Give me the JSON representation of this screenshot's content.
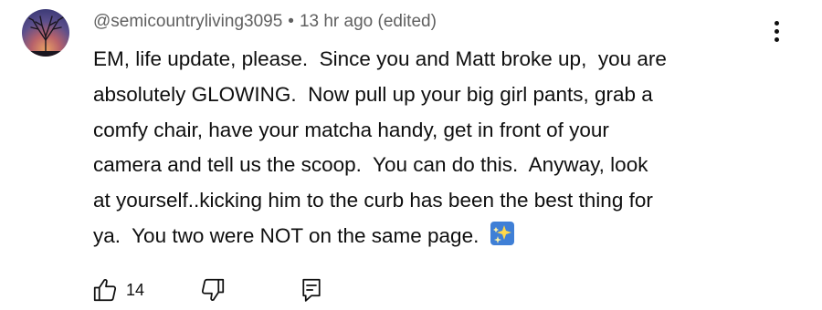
{
  "comment": {
    "author": "@semicountryliving3095",
    "separator": "•",
    "timestamp": "13 hr ago (edited)",
    "lines": [
      "EM, life update, please.  Since you and Matt broke up,  you are",
      "absolutely GLOWING.  Now pull up your big girl pants, grab a",
      "comfy chair, have your matcha handy, get in front of your",
      "camera and tell us the scoop.  You can do this.  Anyway, look",
      "at yourself..kicking him to the curb has been the best thing for",
      "ya.  You two were NOT on the same page. "
    ],
    "emoji": "sparkle-star-emoji",
    "like_count": "14"
  },
  "icons": {
    "like": "thumbs-up-icon",
    "dislike": "thumbs-down-icon",
    "reply": "comment-reply-icon",
    "more": "more-vertical-icon"
  },
  "colors": {
    "text": "#0f0f0f",
    "meta": "#606060",
    "emoji_bg": "#3f7fd6"
  }
}
